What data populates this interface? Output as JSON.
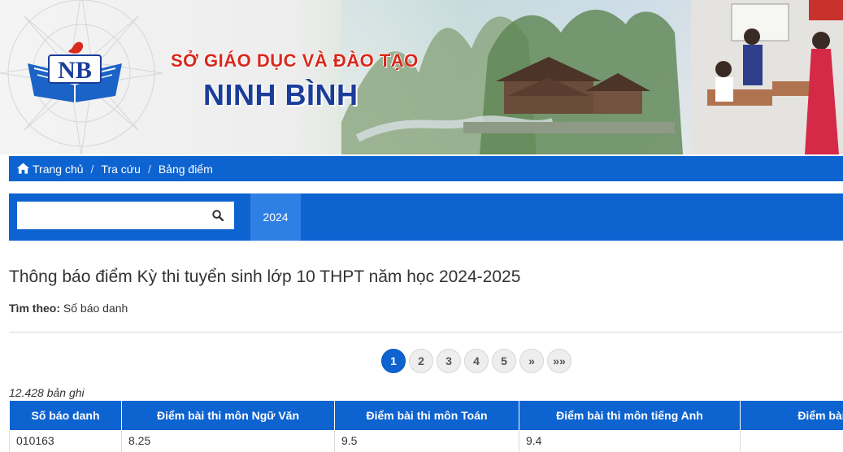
{
  "header": {
    "org_line1": "SỞ GIÁO DỤC VÀ ĐÀO TẠO",
    "org_line2": "NINH BÌNH",
    "logo_text": "NB"
  },
  "breadcrumb": {
    "items": [
      "Trang chủ",
      "Tra cứu",
      "Bảng điểm"
    ],
    "separator": "/"
  },
  "search": {
    "value": "",
    "placeholder": ""
  },
  "tabs": [
    "2024"
  ],
  "main": {
    "title": "Thông báo điểm Kỳ thi tuyển sinh lớp 10 THPT năm học 2024-2025",
    "search_by_label": "Tìm theo:",
    "search_by_value": "Số báo danh",
    "record_count": "12.428 bản ghi"
  },
  "pagination": {
    "pages": [
      "1",
      "2",
      "3",
      "4",
      "5"
    ],
    "active": "1",
    "next": "»",
    "last": "»»"
  },
  "table": {
    "columns": [
      "Số báo danh",
      "Điểm bài thi môn Ngữ Văn",
      "Điểm bài thi môn Toán",
      "Điểm bài thi môn tiếng Anh",
      "Điểm bài thi"
    ],
    "rows": [
      [
        "010163",
        "8.25",
        "9.5",
        "9.4",
        ""
      ]
    ]
  },
  "colors": {
    "primary": "#0d63d0",
    "tab_active": "#2f80e4",
    "title_red": "#d9281c",
    "title_blue": "#1b3d9a"
  },
  "icons": {
    "breadcrumb_home": "home-icon",
    "search": "search-icon"
  }
}
